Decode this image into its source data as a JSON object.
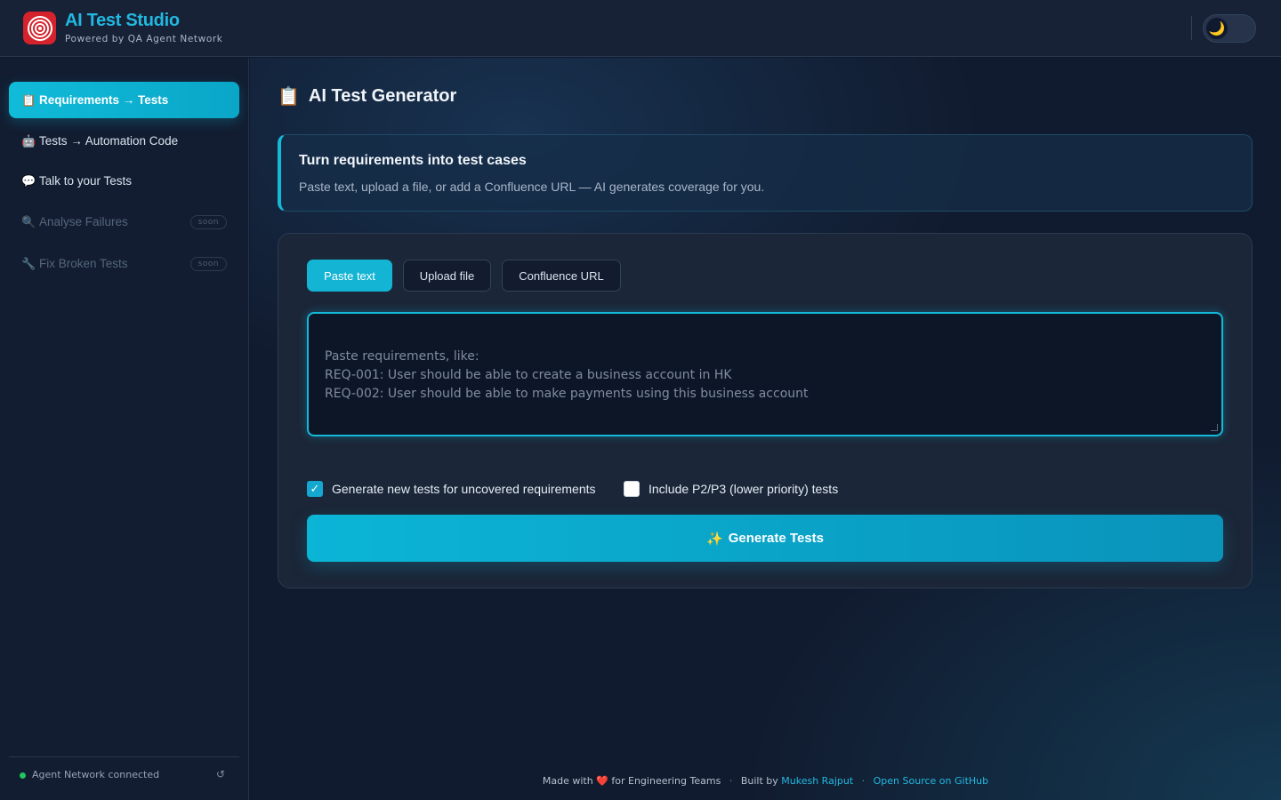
{
  "app": {
    "title": "AI Test Studio",
    "subtitle": "Powered by QA Agent Network",
    "logo_icon": "target-logo",
    "theme_icon": "🌙",
    "accent_color": "#16b8d8"
  },
  "sidebar": {
    "items": [
      {
        "icon": "📋",
        "label": "Requirements → Tests",
        "state": "active"
      },
      {
        "icon": "🤖",
        "label": "Tests → Automation Code",
        "state": "enabled"
      },
      {
        "icon": "💬",
        "label": "Talk to your Tests",
        "state": "enabled"
      },
      {
        "icon": "🔍",
        "label": "Analyse Failures",
        "state": "disabled",
        "badge": "soon"
      },
      {
        "icon": "🔧",
        "label": "Fix Broken Tests",
        "state": "disabled",
        "badge": "soon"
      }
    ],
    "status": {
      "text": "Agent Network connected",
      "color": "#22c55e",
      "refresh_icon": "↺"
    }
  },
  "main": {
    "page_title": {
      "icon": "📋",
      "text": "AI Test Generator"
    },
    "info": {
      "title": "Turn requirements into test cases",
      "description": "Paste text, upload a file, or add a Confluence URL — AI generates coverage for you."
    },
    "tabs": [
      {
        "label": "Paste text",
        "active": true
      },
      {
        "label": "Upload file",
        "active": false
      },
      {
        "label": "Confluence URL",
        "active": false
      }
    ],
    "textarea": {
      "value": "",
      "placeholder": "Paste requirements, like:\nREQ-001: User should be able to create a business account in HK\nREQ-002: User should be able to make payments using this business account"
    },
    "options": [
      {
        "label": "Generate new tests for uncovered requirements",
        "checked": true
      },
      {
        "label": "Include P2/P3 (lower priority) tests",
        "checked": false
      }
    ],
    "generate_button": {
      "icon": "✨",
      "label": "Generate Tests"
    }
  },
  "footer": {
    "made_with": "Made with",
    "heart": "❤️",
    "for_text": "for Engineering Teams",
    "sep": "·",
    "built_by": "Built by",
    "author": "Mukesh Rajput",
    "github": "Open Source on GitHub"
  }
}
